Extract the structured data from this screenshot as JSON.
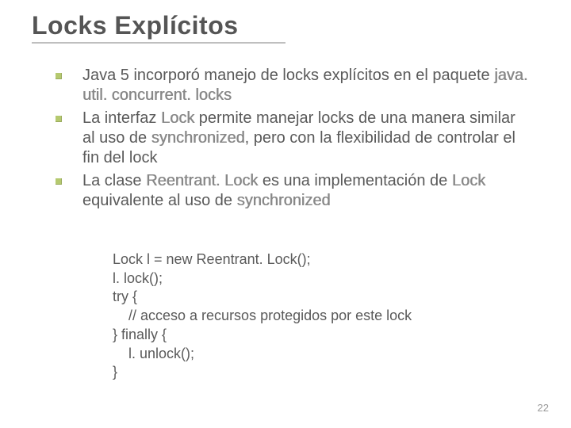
{
  "title": "Locks Explícitos",
  "bullets": [
    {
      "pre": "Java 5 incorporó manejo de locks explícitos en el paquete ",
      "accent1": "java. util. concurrent. locks",
      "post": ""
    },
    {
      "pre": "La interfaz ",
      "accent1": "Lock",
      "mid1": " permite manejar locks de una manera similar al uso de ",
      "accent2": "synchronized",
      "post": ", pero con la flexibilidad de controlar el fin del lock"
    },
    {
      "pre": "La clase ",
      "accent1": "Reentrant. Lock",
      "mid1": " es una implementación de ",
      "accent2": "Lock",
      "mid2": " equivalente al uso de ",
      "accent3": "synchronized",
      "post": ""
    }
  ],
  "code": {
    "l1": "Lock l = new Reentrant. Lock();",
    "l2": "l. lock();",
    "l3": "try {",
    "l4": "// acceso a recursos protegidos por este lock",
    "l5": "} finally {",
    "l6": "l. unlock();",
    "l7": "}"
  },
  "page_number": "22"
}
